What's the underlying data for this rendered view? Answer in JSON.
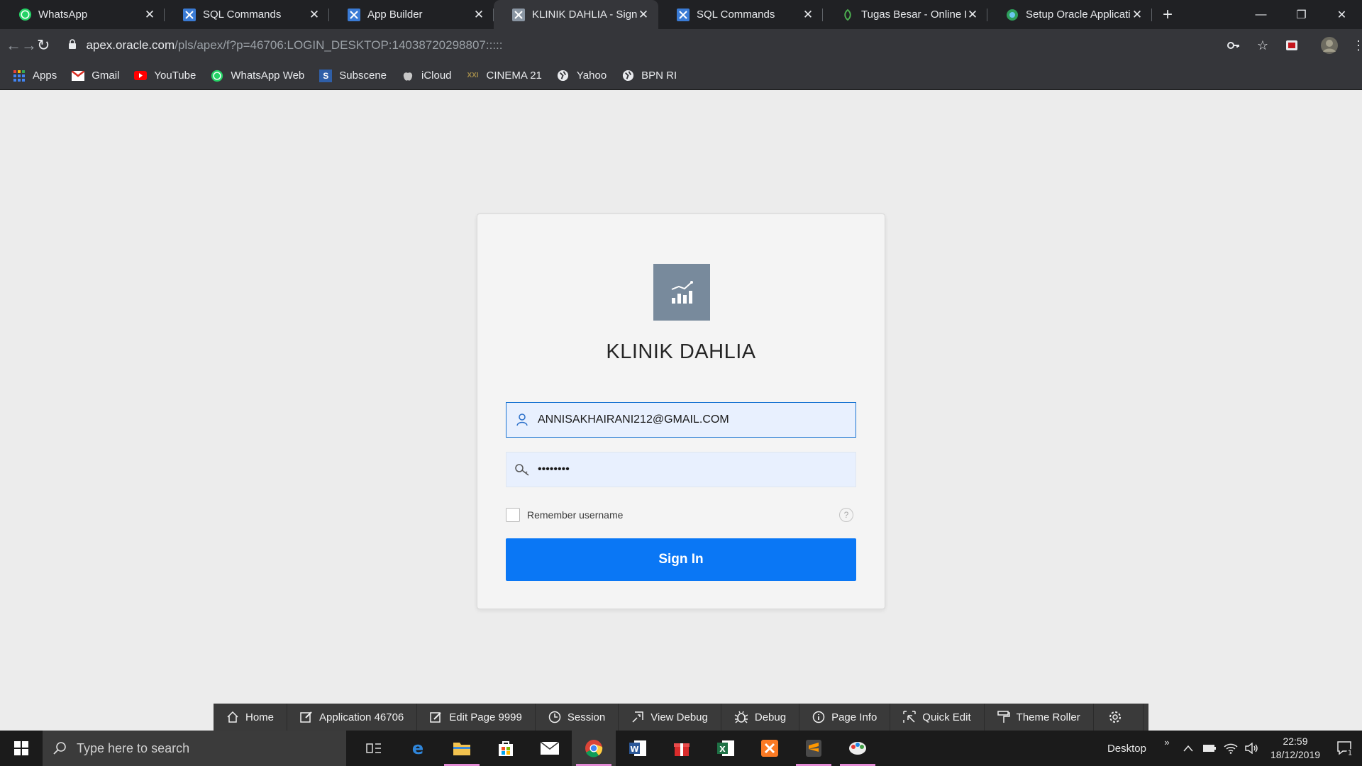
{
  "browser": {
    "tabs": [
      {
        "label": "WhatsApp",
        "icon": "whatsapp-icon",
        "active": false
      },
      {
        "label": "SQL Commands",
        "icon": "apex-icon",
        "active": false
      },
      {
        "label": "App Builder",
        "icon": "apex-icon",
        "active": false
      },
      {
        "label": "KLINIK DAHLIA - Sign I",
        "icon": "apex-icon",
        "active": true
      },
      {
        "label": "SQL Commands",
        "icon": "apex-icon",
        "active": false
      },
      {
        "label": "Tugas Besar - Online L",
        "icon": "leaf-icon",
        "active": false
      },
      {
        "label": "Setup Oracle Applicatic",
        "icon": "globe-icon",
        "active": false
      }
    ],
    "new_tab": "+",
    "url_host": "apex.oracle.com",
    "url_path": "/pls/apex/f?p=46706:LOGIN_DESKTOP:14038720298807:::::",
    "bookmarks": [
      {
        "label": "Apps",
        "icon": "apps-grid-icon"
      },
      {
        "label": "Gmail",
        "icon": "gmail-icon"
      },
      {
        "label": "YouTube",
        "icon": "youtube-icon"
      },
      {
        "label": "WhatsApp Web",
        "icon": "whatsapp-icon"
      },
      {
        "label": "Subscene",
        "icon": "subscene-icon"
      },
      {
        "label": "iCloud",
        "icon": "apple-icon"
      },
      {
        "label": "CINEMA 21",
        "icon": "xxi-icon"
      },
      {
        "label": "Yahoo",
        "icon": "globe-icon"
      },
      {
        "label": "BPN RI",
        "icon": "globe-icon"
      }
    ]
  },
  "login": {
    "app_title": "KLINIK DAHLIA",
    "username_value": "ANNISAKHAIRANI212@GMAIL.COM",
    "password_value": "••••••••",
    "remember_label": "Remember username",
    "help_glyph": "?",
    "sign_in_label": "Sign In",
    "accent_color": "#0a77f5"
  },
  "dev_toolbar": {
    "items": [
      {
        "label": "Home",
        "icon": "home-icon"
      },
      {
        "label": "Application 46706",
        "icon": "edit-app-icon"
      },
      {
        "label": "Edit Page 9999",
        "icon": "edit-page-icon"
      },
      {
        "label": "Session",
        "icon": "clock-icon"
      },
      {
        "label": "View Debug",
        "icon": "view-debug-icon"
      },
      {
        "label": "Debug",
        "icon": "bug-icon"
      },
      {
        "label": "Page Info",
        "icon": "info-icon"
      },
      {
        "label": "Quick Edit",
        "icon": "quick-edit-icon"
      },
      {
        "label": "Theme Roller",
        "icon": "paint-roller-icon"
      }
    ]
  },
  "taskbar": {
    "search_placeholder": "Type here to search",
    "desktop_label": "Desktop",
    "time": "22:59",
    "date": "18/12/2019",
    "notification_count": "1"
  }
}
